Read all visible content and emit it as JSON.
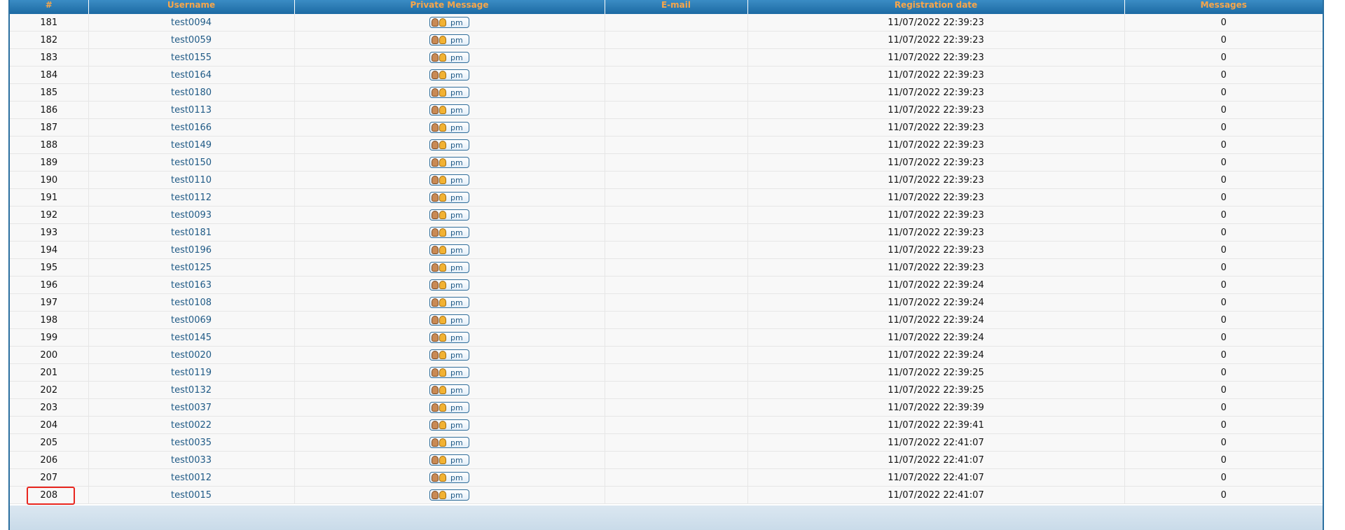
{
  "table": {
    "headers": [
      "#",
      "Username",
      "Private Message",
      "E-mail",
      "Registration date",
      "Messages"
    ],
    "pm_label": "pm",
    "rows": [
      {
        "num": "181",
        "username": "test0094",
        "email": "",
        "reg_date": "11/07/2022 22:39:23",
        "messages": "0"
      },
      {
        "num": "182",
        "username": "test0059",
        "email": "",
        "reg_date": "11/07/2022 22:39:23",
        "messages": "0"
      },
      {
        "num": "183",
        "username": "test0155",
        "email": "",
        "reg_date": "11/07/2022 22:39:23",
        "messages": "0"
      },
      {
        "num": "184",
        "username": "test0164",
        "email": "",
        "reg_date": "11/07/2022 22:39:23",
        "messages": "0"
      },
      {
        "num": "185",
        "username": "test0180",
        "email": "",
        "reg_date": "11/07/2022 22:39:23",
        "messages": "0"
      },
      {
        "num": "186",
        "username": "test0113",
        "email": "",
        "reg_date": "11/07/2022 22:39:23",
        "messages": "0"
      },
      {
        "num": "187",
        "username": "test0166",
        "email": "",
        "reg_date": "11/07/2022 22:39:23",
        "messages": "0"
      },
      {
        "num": "188",
        "username": "test0149",
        "email": "",
        "reg_date": "11/07/2022 22:39:23",
        "messages": "0"
      },
      {
        "num": "189",
        "username": "test0150",
        "email": "",
        "reg_date": "11/07/2022 22:39:23",
        "messages": "0"
      },
      {
        "num": "190",
        "username": "test0110",
        "email": "",
        "reg_date": "11/07/2022 22:39:23",
        "messages": "0"
      },
      {
        "num": "191",
        "username": "test0112",
        "email": "",
        "reg_date": "11/07/2022 22:39:23",
        "messages": "0"
      },
      {
        "num": "192",
        "username": "test0093",
        "email": "",
        "reg_date": "11/07/2022 22:39:23",
        "messages": "0"
      },
      {
        "num": "193",
        "username": "test0181",
        "email": "",
        "reg_date": "11/07/2022 22:39:23",
        "messages": "0"
      },
      {
        "num": "194",
        "username": "test0196",
        "email": "",
        "reg_date": "11/07/2022 22:39:23",
        "messages": "0"
      },
      {
        "num": "195",
        "username": "test0125",
        "email": "",
        "reg_date": "11/07/2022 22:39:23",
        "messages": "0"
      },
      {
        "num": "196",
        "username": "test0163",
        "email": "",
        "reg_date": "11/07/2022 22:39:24",
        "messages": "0"
      },
      {
        "num": "197",
        "username": "test0108",
        "email": "",
        "reg_date": "11/07/2022 22:39:24",
        "messages": "0"
      },
      {
        "num": "198",
        "username": "test0069",
        "email": "",
        "reg_date": "11/07/2022 22:39:24",
        "messages": "0"
      },
      {
        "num": "199",
        "username": "test0145",
        "email": "",
        "reg_date": "11/07/2022 22:39:24",
        "messages": "0"
      },
      {
        "num": "200",
        "username": "test0020",
        "email": "",
        "reg_date": "11/07/2022 22:39:24",
        "messages": "0"
      },
      {
        "num": "201",
        "username": "test0119",
        "email": "",
        "reg_date": "11/07/2022 22:39:25",
        "messages": "0"
      },
      {
        "num": "202",
        "username": "test0132",
        "email": "",
        "reg_date": "11/07/2022 22:39:25",
        "messages": "0"
      },
      {
        "num": "203",
        "username": "test0037",
        "email": "",
        "reg_date": "11/07/2022 22:39:39",
        "messages": "0"
      },
      {
        "num": "204",
        "username": "test0022",
        "email": "",
        "reg_date": "11/07/2022 22:39:41",
        "messages": "0"
      },
      {
        "num": "205",
        "username": "test0035",
        "email": "",
        "reg_date": "11/07/2022 22:41:07",
        "messages": "0"
      },
      {
        "num": "206",
        "username": "test0033",
        "email": "",
        "reg_date": "11/07/2022 22:41:07",
        "messages": "0"
      },
      {
        "num": "207",
        "username": "test0012",
        "email": "",
        "reg_date": "11/07/2022 22:41:07",
        "messages": "0"
      },
      {
        "num": "208",
        "username": "test0015",
        "email": "",
        "reg_date": "11/07/2022 22:41:07",
        "messages": "0"
      }
    ]
  },
  "colors": {
    "header_bg": "#1c6aa3",
    "header_text": "#f7a64a",
    "link": "#1f5a86",
    "highlight_border": "#e8261f"
  },
  "icons": {
    "pm": "private-message-icon"
  }
}
